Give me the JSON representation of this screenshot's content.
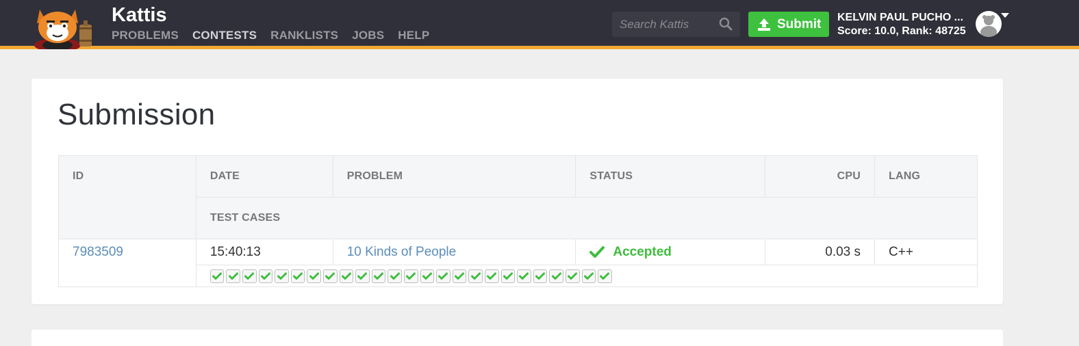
{
  "header": {
    "brand": "Kattis",
    "nav": [
      {
        "label": "PROBLEMS",
        "active": false
      },
      {
        "label": "CONTESTS",
        "active": true
      },
      {
        "label": "RANKLISTS",
        "active": false
      },
      {
        "label": "JOBS",
        "active": false
      },
      {
        "label": "HELP",
        "active": false
      }
    ],
    "search_placeholder": "Search Kattis",
    "submit_label": "Submit",
    "user_name": "KELVIN PAUL PUCHO ...",
    "user_stats": "Score: 10.0, Rank: 48725"
  },
  "main": {
    "title": "Submission",
    "columns": {
      "id": "ID",
      "date": "DATE",
      "problem": "PROBLEM",
      "status": "STATUS",
      "cpu": "CPU",
      "lang": "LANG",
      "test_cases": "TEST CASES"
    },
    "submission": {
      "id": "7983509",
      "date": "15:40:13",
      "problem": "10 Kinds of People",
      "status": "Accepted",
      "cpu": "0.03 s",
      "lang": "C++",
      "test_cases_passed": 25
    }
  },
  "colors": {
    "header_bg": "#30303a",
    "header_accent": "#f0a830",
    "submit_green": "#3ec13e",
    "accepted_green": "#3ebd3e",
    "link_blue": "#5b8db8"
  }
}
